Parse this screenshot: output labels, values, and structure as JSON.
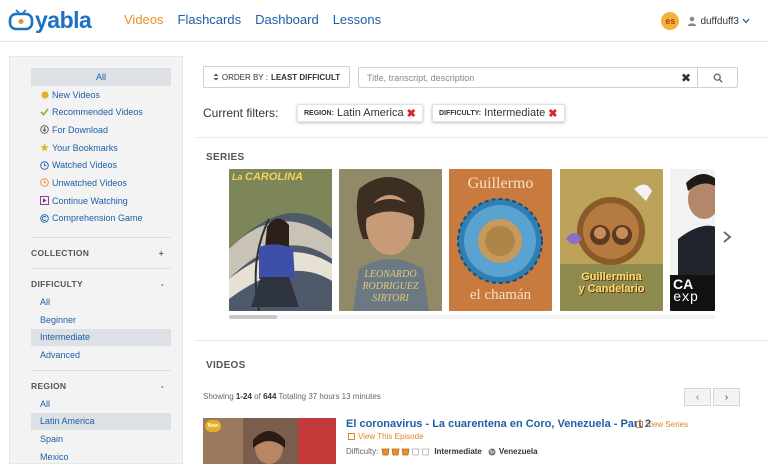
{
  "header": {
    "logo_text": "yabla",
    "nav": [
      {
        "label": "Videos",
        "active": true
      },
      {
        "label": "Flashcards",
        "active": false
      },
      {
        "label": "Dashboard",
        "active": false
      },
      {
        "label": "Lessons",
        "active": false
      }
    ],
    "language_badge": "es",
    "username": "duffduff3"
  },
  "sidebar": {
    "all_label": "All",
    "items": [
      {
        "label": "New Videos",
        "icon": "new-dot-icon"
      },
      {
        "label": "Recommended Videos",
        "icon": "checkmark-icon"
      },
      {
        "label": "For Download",
        "icon": "download-icon"
      },
      {
        "label": "Your Bookmarks",
        "icon": "star-icon"
      },
      {
        "label": "Watched Videos",
        "icon": "clock-icon"
      },
      {
        "label": "Unwatched Videos",
        "icon": "clock-icon"
      },
      {
        "label": "Continue Watching",
        "icon": "play-icon"
      },
      {
        "label": "Comprehension Game",
        "icon": "copyright-icon"
      }
    ],
    "collection": {
      "title": "COLLECTION",
      "toggle": "+"
    },
    "difficulty": {
      "title": "DIFFICULTY",
      "toggle": "-",
      "options": [
        "All",
        "Beginner",
        "Intermediate",
        "Advanced"
      ],
      "selected": "Intermediate"
    },
    "region": {
      "title": "REGION",
      "toggle": "-",
      "options": [
        "All",
        "Latin America",
        "Spain",
        "Mexico"
      ],
      "selected": "Latin America"
    }
  },
  "toolbar": {
    "order_prefix": "ORDER BY :",
    "order_value": "LEAST DIFFICULT",
    "search_placeholder": "Title, transcript, description",
    "search_value": ""
  },
  "filters": {
    "label": "Current filters:",
    "chips": [
      {
        "key": "REGION:",
        "value": "Latin America"
      },
      {
        "key": "DIFFICULTY:",
        "value": "Intermediate"
      }
    ]
  },
  "series": {
    "title": "SERIES",
    "posters": [
      {
        "title_top": "La",
        "title_main": "CAROLINA",
        "name": "la-carolina"
      },
      {
        "title_line1": "LEONARDO",
        "title_line2": "RODRIGUEZ",
        "title_line3": "SIRTORI",
        "name": "leonardo-rodriguez-sirtori"
      },
      {
        "title_top": "Guillermo",
        "title_bottom": "el chamán",
        "name": "guillermo-el-chaman"
      },
      {
        "title_line1": "Guillermina",
        "title_line2": "y Candelario",
        "name": "guillermina-y-candelario"
      },
      {
        "title_line1": "CA",
        "title_line2": "exp",
        "name": "partial-series"
      }
    ]
  },
  "videos": {
    "title": "VIDEOS",
    "showing_prefix": "Showing",
    "showing_range": "1-24",
    "showing_of": "of",
    "showing_total": "644",
    "showing_suffix": "Totaling 37 hours 13 minutes",
    "prev": "‹",
    "next": "›",
    "first": {
      "badge": "New",
      "title": "El coronavirus - La cuarentena en Coro, Venezuela - Part 2",
      "view_series": "View Series",
      "view_episode": "View This Episode",
      "difficulty_label": "Difficulty:",
      "difficulty_level": 3,
      "difficulty_max": 5,
      "difficulty_value": "Intermediate",
      "country": "Venezuela"
    }
  },
  "colors": {
    "brand_blue": "#1c72c4",
    "link_blue": "#1d5fa5",
    "accent_orange": "#e8902c",
    "remove_red": "#d9232e"
  }
}
